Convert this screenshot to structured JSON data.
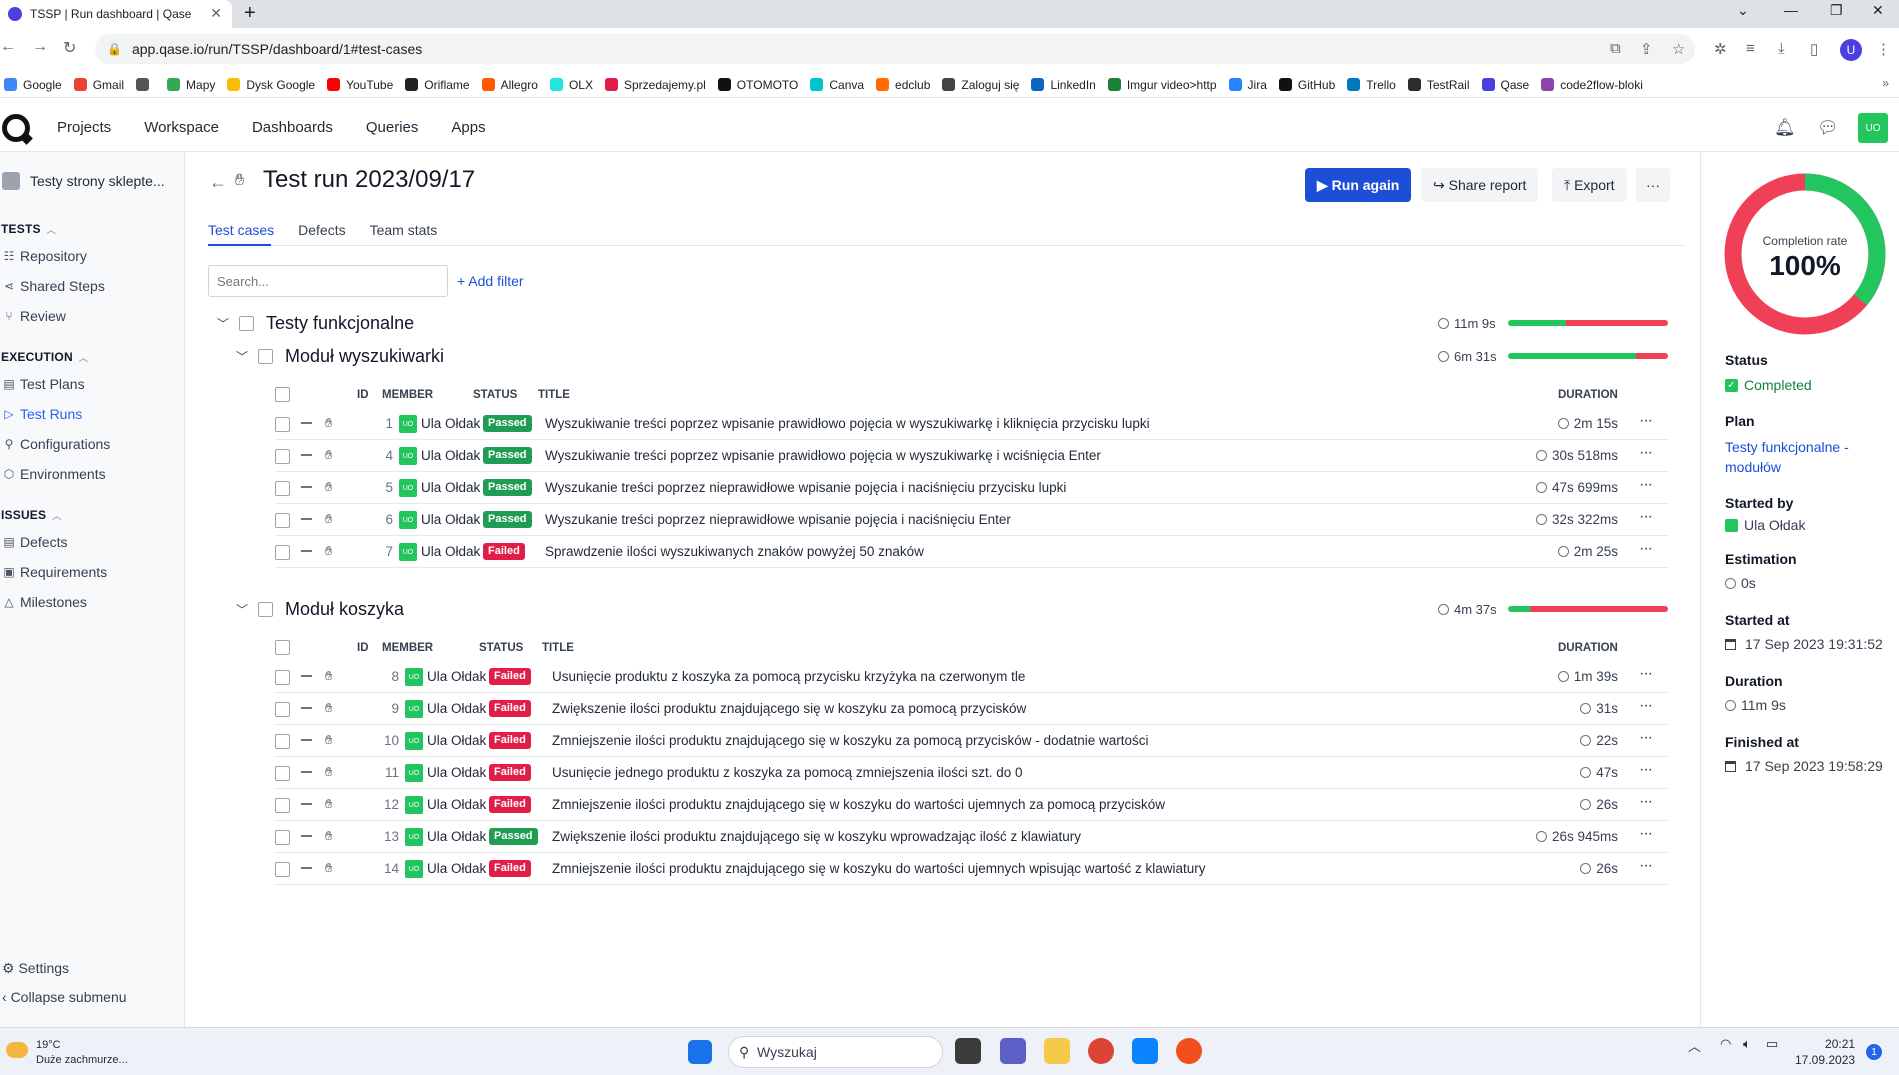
{
  "browser": {
    "tab_title": "TSSP | Run dashboard | Qase",
    "url": "app.qase.io/run/TSSP/dashboard/1#test-cases",
    "profile_initial": "U",
    "bookmarks": [
      "Google",
      "Gmail",
      "",
      "Mapy",
      "Dysk Google",
      "YouTube",
      "Oriflame",
      "Allegro",
      "OLX",
      "Sprzedajemy.pl",
      "OTOMOTO",
      "Canva",
      "edclub",
      "Zaloguj się",
      "LinkedIn",
      "Imgur video>http",
      "Jira",
      "GitHub",
      "Trello",
      "TestRail",
      "Qase",
      "code2flow-bloki"
    ],
    "bookmark_colors": [
      "#4285f4",
      "#ea4335",
      "#555555",
      "#34a853",
      "#fbbc04",
      "#ff0000",
      "#222222",
      "#ff5a00",
      "#23e5db",
      "#e11d48",
      "#111111",
      "#00c4cc",
      "#ff6b00",
      "#444444",
      "#0a66c2",
      "#1e7e34",
      "#2684ff",
      "#111111",
      "#0079bf",
      "#2d2d2d",
      "#4b3fe0",
      "#8e44ad"
    ]
  },
  "app": {
    "nav": [
      "Projects",
      "Workspace",
      "Dashboards",
      "Queries",
      "Apps"
    ],
    "user_initials": "UO"
  },
  "sidebar": {
    "project": "Testy strony sklepte...",
    "tests_header": "TESTS",
    "tests_items": [
      "Repository",
      "Shared Steps",
      "Review"
    ],
    "execution_header": "EXECUTION",
    "execution_items": [
      "Test Plans",
      "Test Runs",
      "Configurations",
      "Environments"
    ],
    "issues_header": "ISSUES",
    "issues_items": [
      "Defects",
      "Requirements",
      "Milestones"
    ],
    "settings": "Settings",
    "collapse": "Collapse submenu"
  },
  "main": {
    "title": "Test run 2023/09/17",
    "run_again": "Run again",
    "share_report": "Share report",
    "export": "Export",
    "more": "···",
    "tabs": [
      "Test cases",
      "Defects",
      "Team stats"
    ],
    "search_placeholder": "Search...",
    "add_filter": "+ Add filter",
    "columns": {
      "id": "ID",
      "member": "MEMBER",
      "status": "STATUS",
      "title": "TITLE",
      "duration": "DURATION"
    },
    "root_suite": {
      "name": "Testy funkcjonalne",
      "duration": "11m 9s",
      "passed_fraction": 0.36
    },
    "suites": [
      {
        "name": "Moduł wyszukiwarki",
        "duration": "6m 31s",
        "passed_fraction": 0.8,
        "rows": [
          {
            "id": "1",
            "member": "Ula Ołdak",
            "status": "Passed",
            "title": "Wyszukiwanie treści poprzez wpisanie prawidłowo pojęcia w wyszukiwarkę i kliknięcia przycisku lupki",
            "duration": "2m 15s"
          },
          {
            "id": "4",
            "member": "Ula Ołdak",
            "status": "Passed",
            "title": "Wyszukiwanie treści poprzez wpisanie prawidłowo pojęcia w wyszukiwarkę i wciśnięcia Enter",
            "duration": "30s 518ms"
          },
          {
            "id": "5",
            "member": "Ula Ołdak",
            "status": "Passed",
            "title": "Wyszukanie treści poprzez nieprawidłowe wpisanie pojęcia i naciśnięciu przycisku lupki",
            "duration": "47s 699ms"
          },
          {
            "id": "6",
            "member": "Ula Ołdak",
            "status": "Passed",
            "title": "Wyszukanie treści poprzez nieprawidłowe wpisanie pojęcia i naciśnięciu Enter",
            "duration": "32s 322ms"
          },
          {
            "id": "7",
            "member": "Ula Ołdak",
            "status": "Failed",
            "title": "Sprawdzenie ilości wyszukiwanych znaków powyżej 50 znaków",
            "duration": "2m 25s"
          }
        ]
      },
      {
        "name": "Moduł koszyka",
        "duration": "4m 37s",
        "passed_fraction": 0.14,
        "rows": [
          {
            "id": "8",
            "member": "Ula Ołdak",
            "status": "Failed",
            "title": "Usunięcie produktu z koszyka za pomocą przycisku krzyżyka na czerwonym tle",
            "duration": "1m 39s"
          },
          {
            "id": "9",
            "member": "Ula Ołdak",
            "status": "Failed",
            "title": "Zwiększenie ilości produktu znajdującego się w koszyku za pomocą przycisków",
            "duration": "31s"
          },
          {
            "id": "10",
            "member": "Ula Ołdak",
            "status": "Failed",
            "title": "Zmniejszenie ilości produktu znajdującego się w koszyku za pomocą przycisków - dodatnie wartości",
            "duration": "22s"
          },
          {
            "id": "11",
            "member": "Ula Ołdak",
            "status": "Failed",
            "title": "Usunięcie jednego produktu z koszyka za pomocą zmniejszenia ilości szt. do 0",
            "duration": "47s"
          },
          {
            "id": "12",
            "member": "Ula Ołdak",
            "status": "Failed",
            "title": "Zmniejszenie ilości produktu znajdującego się w koszyku do wartości ujemnych za pomocą przycisków",
            "duration": "26s"
          },
          {
            "id": "13",
            "member": "Ula Ołdak",
            "status": "Passed",
            "title": "Zwiększenie ilości produktu znajdującego się w koszyku wprowadzając ilość z klawiatury",
            "duration": "26s 945ms"
          },
          {
            "id": "14",
            "member": "Ula Ołdak",
            "status": "Failed",
            "title": "Zmniejszenie ilości produktu znajdującego się w koszyku do wartości ujemnych wpisując wartość z klawiatury",
            "duration": "26s"
          }
        ]
      }
    ]
  },
  "panel": {
    "completion_label": "Completion rate",
    "completion_value": "100%",
    "passed_fraction": 0.36,
    "status_label": "Status",
    "status_value": "Completed",
    "plan_label": "Plan",
    "plan_value": "Testy funkcjonalne - modułów",
    "started_by_label": "Started by",
    "started_by_value": "Ula Ołdak",
    "estimation_label": "Estimation",
    "estimation_value": "0s",
    "started_at_label": "Started at",
    "started_at_value": "17 Sep 2023 19:31:52",
    "duration_label": "Duration",
    "duration_value": "11m 9s",
    "finished_at_label": "Finished at",
    "finished_at_value": "17 Sep 2023 19:58:29"
  },
  "colors": {
    "passed": "#1f9d55",
    "failed": "#e11d48",
    "bar_green": "#22c55e",
    "bar_red": "#ef4057",
    "accent": "#1d4ed8"
  },
  "taskbar": {
    "temp": "19°C",
    "weather": "Duże zachmurze...",
    "search": "Wyszukaj",
    "time": "20:21",
    "date": "17.09.2023",
    "notifications": "1"
  }
}
